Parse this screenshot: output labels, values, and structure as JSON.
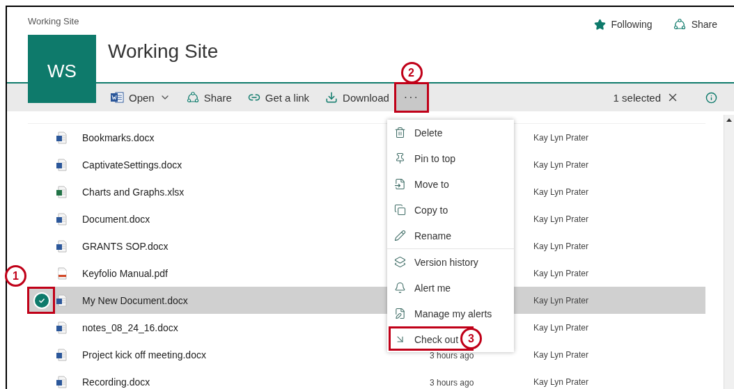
{
  "site": {
    "breadcrumb": "Working Site",
    "title": "Working Site",
    "logo": "WS",
    "following": {
      "label": "Following",
      "on": true
    },
    "share": "Share"
  },
  "toolbar": {
    "commands": [
      {
        "label": "Open",
        "dropdown": true
      },
      {
        "label": "Share",
        "dropdown": false
      },
      {
        "label": "Get a link",
        "dropdown": false
      },
      {
        "label": "Download",
        "dropdown": false
      }
    ],
    "more": {
      "label": "···",
      "pressed": true,
      "callout": "2"
    },
    "selection": "1 selected"
  },
  "files": [
    {
      "name": "Bookmarks.docx",
      "kind": "word",
      "modified_by": "Kay Lyn Prater",
      "selected": false
    },
    {
      "name": "CaptivateSettings.docx",
      "kind": "word",
      "modified_by": "Kay Lyn Prater",
      "selected": false
    },
    {
      "name": "Charts and Graphs.xlsx",
      "kind": "excel",
      "modified_by": "Kay Lyn Prater",
      "selected": false
    },
    {
      "name": "Document.docx",
      "kind": "word",
      "modified_by": "Kay Lyn Prater",
      "selected": false
    },
    {
      "name": "GRANTS SOP.docx",
      "kind": "word",
      "modified_by": "Kay Lyn Prater",
      "selected": false
    },
    {
      "name": "Keyfolio Manual.pdf",
      "kind": "pdf",
      "modified_by": "Kay Lyn Prater",
      "selected": false
    },
    {
      "name": "My New Document.docx",
      "kind": "word",
      "modified_by": "Kay Lyn Prater",
      "selected": true,
      "callout": "1"
    },
    {
      "name": "notes_08_24_16.docx",
      "kind": "word",
      "modified_by": "Kay Lyn Prater",
      "selected": false
    },
    {
      "name": "Project kick off meeting.docx",
      "kind": "word",
      "modified": "3 hours ago",
      "modified_by": "Kay Lyn Prater",
      "selected": false
    },
    {
      "name": "Recording.docx",
      "kind": "word",
      "modified": "3 hours ago",
      "modified_by": "Kay Lyn Prater",
      "selected": false
    }
  ],
  "menu": {
    "groups": [
      [
        {
          "label": "Delete"
        },
        {
          "label": "Pin to top"
        },
        {
          "label": "Move to"
        },
        {
          "label": "Copy to"
        },
        {
          "label": "Rename"
        }
      ],
      [
        {
          "label": "Version history"
        },
        {
          "label": "Alert me"
        },
        {
          "label": "Manage my alerts"
        },
        {
          "label": "Check out",
          "callout": "3"
        }
      ]
    ]
  }
}
